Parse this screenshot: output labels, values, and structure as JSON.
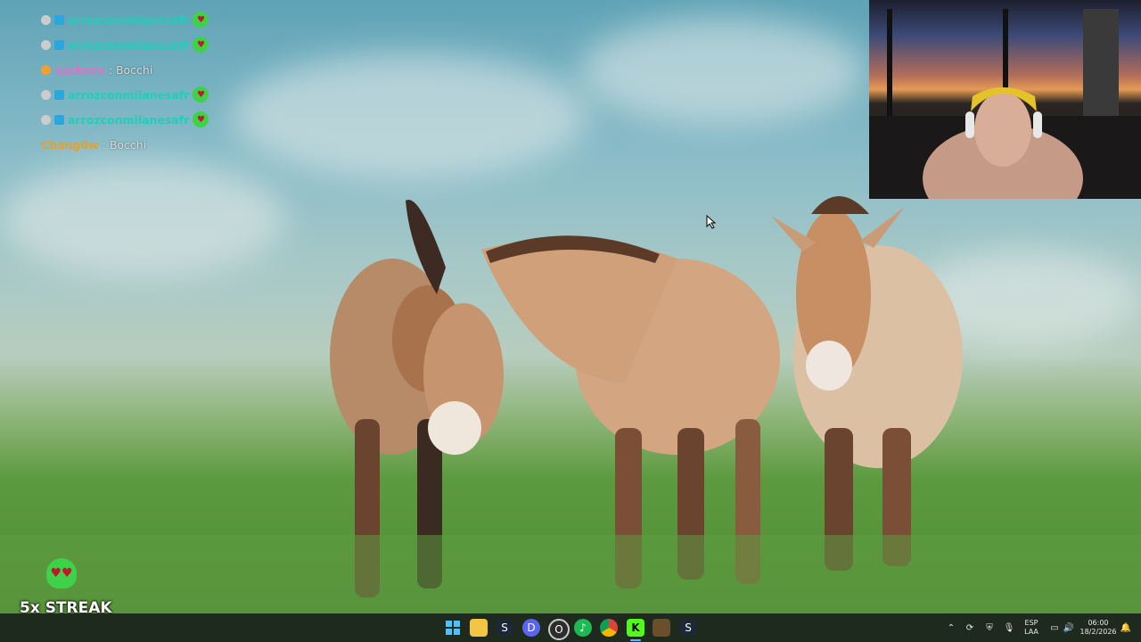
{
  "chat": {
    "messages": [
      {
        "user": "arrozconmilanesafr",
        "message": "",
        "user_color": "#1ecfbc",
        "has_emote": true
      },
      {
        "user": "arrozconmilanesafr",
        "message": "",
        "user_color": "#1ecfbc",
        "has_emote": true
      },
      {
        "user": "sackxvu",
        "message": "Bocchi",
        "user_color": "#e070c8",
        "has_emote": false
      },
      {
        "user": "arrozconmilanesafr",
        "message": "",
        "user_color": "#1ecfbc",
        "has_emote": true
      },
      {
        "user": "arrozconmilanesafr",
        "message": "",
        "user_color": "#1ecfbc",
        "has_emote": true
      },
      {
        "user": "Chang0w",
        "message": "Bocchi",
        "user_color": "#e5a12a",
        "has_emote": false
      }
    ]
  },
  "streak": {
    "label": "5x STREAK"
  },
  "taskbar": {
    "apps": [
      "start-icon",
      "file-explorer-icon",
      "steam-icon",
      "discord-icon",
      "obs-icon",
      "spotify-icon",
      "chrome-icon",
      "kick-icon",
      "minecraft-icon",
      "steam-icon"
    ],
    "tray": {
      "language": "ESP",
      "layout": "LAA",
      "time": "06:00",
      "date": "18/2/2026"
    }
  },
  "colors": {
    "taskbar_bg": "#1f2a1f",
    "accent_green": "#3fd14a"
  }
}
